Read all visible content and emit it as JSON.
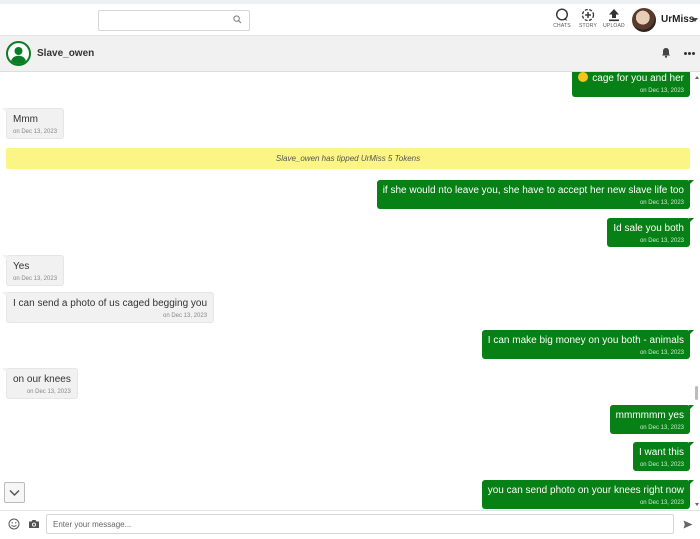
{
  "topbar": {
    "search_placeholder": "",
    "nav": [
      {
        "label": "CHATS",
        "icon": "chat-icon"
      },
      {
        "label": "STORY",
        "icon": "story-add-icon"
      },
      {
        "label": "UPLOAD",
        "icon": "upload-icon"
      }
    ],
    "username": "UrMiss"
  },
  "chat": {
    "contact_name": "Slave_owen"
  },
  "messages": [
    {
      "dir": "out",
      "text": "cage for you and her",
      "date": "on Dec 13, 2023",
      "emoji": true
    },
    {
      "dir": "in",
      "text": "Mmm",
      "date": "on Dec 13, 2023"
    },
    {
      "dir": "system",
      "text": "Slave_owen has tipped UrMiss 5 Tokens"
    },
    {
      "dir": "out",
      "text": "if she would nto leave you, she have to accept her new slave life too",
      "date": "on Dec 13, 2023"
    },
    {
      "dir": "out",
      "text": "Id sale you both",
      "date": "on Dec 13, 2023"
    },
    {
      "dir": "in",
      "text": "Yes",
      "date": "on Dec 13, 2023"
    },
    {
      "dir": "in",
      "text": "I can send a photo of us caged begging you",
      "date": "on Dec 13, 2023"
    },
    {
      "dir": "out",
      "text": "I can make big money on you both - animals",
      "date": "on Dec 13, 2023"
    },
    {
      "dir": "in",
      "text": "on our knees",
      "date": "on Dec 13, 2023"
    },
    {
      "dir": "out",
      "text": "mmmmmm yes",
      "date": "on Dec 13, 2023"
    },
    {
      "dir": "out",
      "text": "I want this",
      "date": "on Dec 13, 2023"
    },
    {
      "dir": "out",
      "text": "you can send photo on your knees right now",
      "date": "on Dec 13, 2023"
    }
  ],
  "composer": {
    "placeholder": "Enter your message..."
  },
  "colors": {
    "outgoing_bubble": "#078016",
    "incoming_bubble": "#f1f1f1",
    "tip_banner": "#fbf586"
  }
}
